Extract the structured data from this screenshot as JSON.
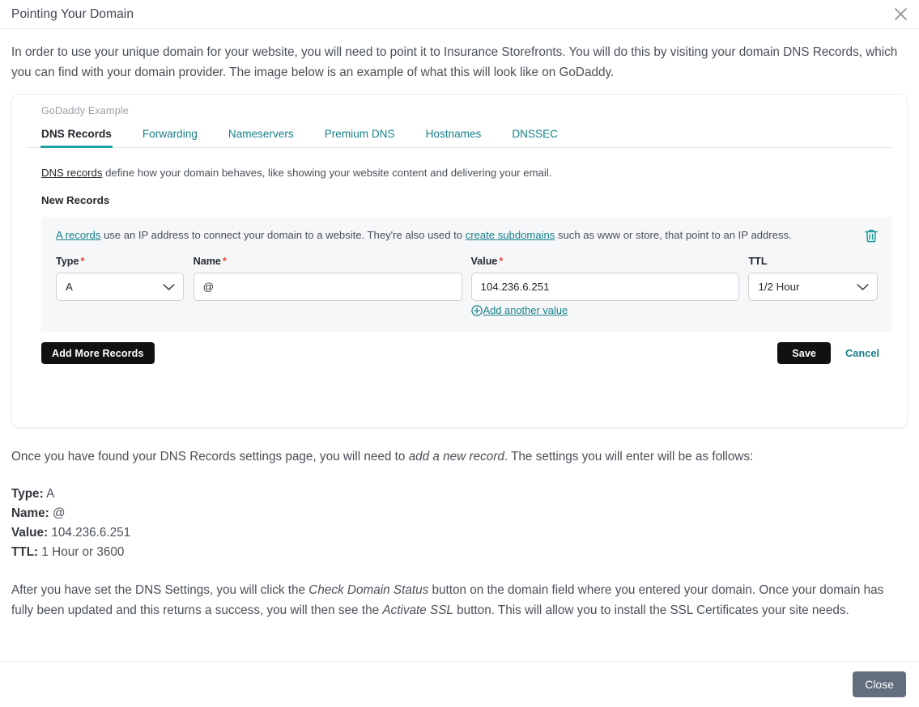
{
  "modal": {
    "title": "Pointing Your Domain",
    "close_icon": "close-icon",
    "intro": "In order to use your unique domain for your website, you will need to point it to Insurance Storefronts. You will do this by visiting your domain DNS Records, which you can find with your domain provider. The image below is an example of what this will look like on GoDaddy.",
    "footer": {
      "close_label": "Close"
    }
  },
  "example": {
    "caption": "GoDaddy Example",
    "tabs": [
      {
        "label": "DNS Records",
        "active": true
      },
      {
        "label": "Forwarding",
        "active": false
      },
      {
        "label": "Nameservers",
        "active": false
      },
      {
        "label": "Premium DNS",
        "active": false
      },
      {
        "label": "Hostnames",
        "active": false
      },
      {
        "label": "DNSSEC",
        "active": false
      }
    ],
    "dns_intro_link": "DNS records",
    "dns_intro_rest": " define how your domain behaves, like showing your website content and delivering your email.",
    "new_records_heading": "New Records",
    "record": {
      "desc_link_1": "A records",
      "desc_mid": " use an IP address to connect your domain to a website. They're also used to ",
      "desc_link_2": "create subdomains",
      "desc_end": " such as www or store, that point to an IP address.",
      "delete_icon": "trash-icon",
      "fields": {
        "type": {
          "label": "Type",
          "required": "*",
          "value": "A"
        },
        "name": {
          "label": "Name",
          "required": "*",
          "value": "@"
        },
        "value": {
          "label": "Value",
          "required": "*",
          "value": "104.236.6.251"
        },
        "ttl": {
          "label": "TTL",
          "required": "",
          "value": "1/2 Hour"
        }
      },
      "add_another_value": "Add another value",
      "add_icon": "plus-circle-icon"
    },
    "actions": {
      "add_more_records": "Add More Records",
      "save": "Save",
      "cancel": "Cancel"
    },
    "colors": {
      "teal": "#1ba3a3",
      "link_teal": "#17818b",
      "dark_button": "#111111",
      "required_red": "#e8432f",
      "close_button": "#626d7d"
    }
  },
  "after": {
    "paragraph_1_a": "Once you have found your DNS Records settings page, you will need to ",
    "paragraph_1_em": "add a new record",
    "paragraph_1_b": ". The settings you will enter will be as follows:",
    "spec": [
      {
        "label": "Type:",
        "value": "A"
      },
      {
        "label": "Name:",
        "value": "@"
      },
      {
        "label": "Value:",
        "value": "104.236.6.251"
      },
      {
        "label": "TTL:",
        "value": "1 Hour or 3600"
      }
    ],
    "paragraph_2_a": "After you have set the DNS Settings, you will click the ",
    "paragraph_2_em1": "Check Domain Status",
    "paragraph_2_b": " button on the domain field where you entered your domain. Once your domain has fully been updated and this returns a success, you will then see the ",
    "paragraph_2_em2": "Activate SSL",
    "paragraph_2_c": " button. This will allow you to install the SSL Certificates your site needs."
  }
}
